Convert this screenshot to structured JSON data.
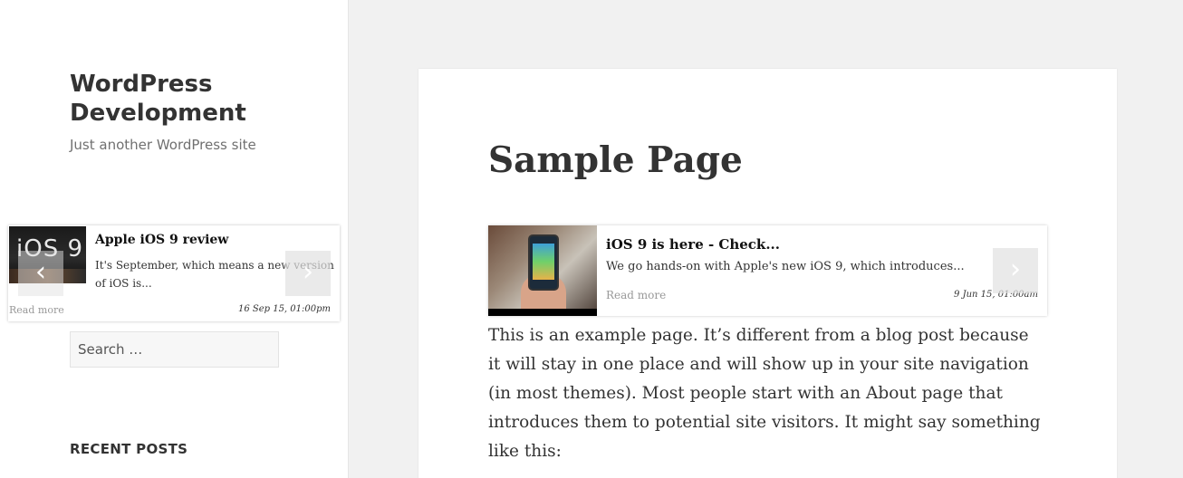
{
  "site": {
    "title": "WordPress Development",
    "description": "Just another WordPress site"
  },
  "sidebar_widget": {
    "thumb_text": "iOS 9",
    "title": "Apple iOS 9 review",
    "excerpt": "It's September, which means a new version of iOS is...",
    "read_more": "Read more",
    "date": "16 Sep 15, 01:00pm",
    "prev_icon": "chevron-left",
    "next_icon": "chevron-right"
  },
  "search": {
    "placeholder": "Search …"
  },
  "recent_posts": {
    "heading": "RECENT POSTS"
  },
  "page": {
    "title": "Sample Page",
    "card": {
      "title": "iOS 9 is here - Check...",
      "excerpt": "We go hands-on with Apple's new iOS 9, which introduces...",
      "read_more": "Read more",
      "date": "9 Jun 15, 01:00am",
      "next_icon": "chevron-right"
    },
    "body": "This is an example page. It’s different from a blog post because it will stay in one place and will show up in your site navigation (in most themes). Most people start with an About page that introduces them to potential site visitors. It might say something like this:"
  }
}
